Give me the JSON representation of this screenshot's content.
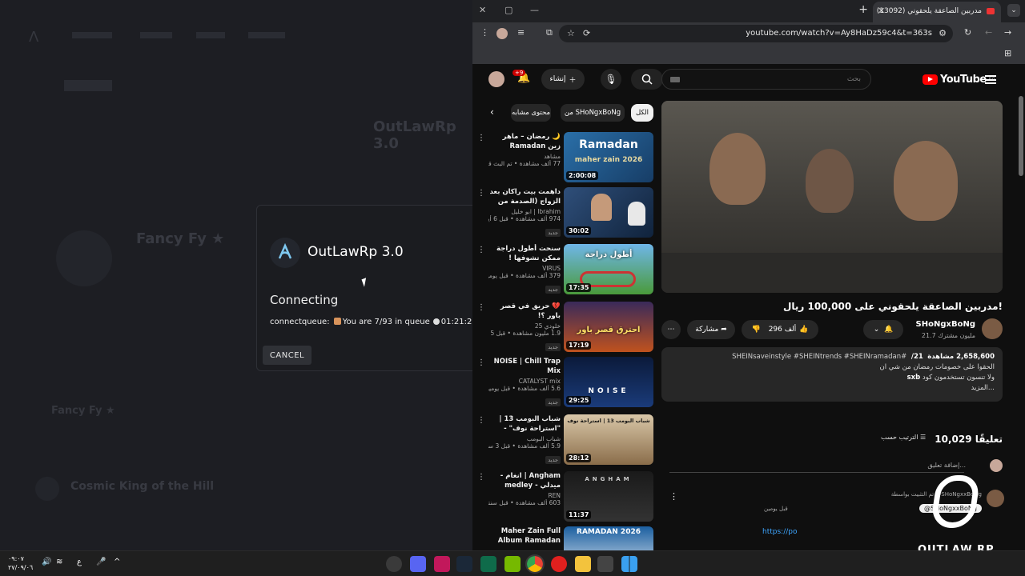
{
  "launcher": {
    "dialog_title": "OutLawRp 3.0",
    "status": "Connecting",
    "queue_text": "connectqueue: ",
    "queue_position": "You are 7/93 in queue",
    "queue_time": "01:21:21",
    "cancel_label": "CANCEL",
    "background": {
      "brand": "OutLawRp 3.0",
      "player_name": "Fancy Fy ★",
      "player_name2": "Fancy Fy ★",
      "song": "Cosmic King of the Hill"
    }
  },
  "browser": {
    "tab_title": "(13092) مدربين الصاعقة يلحقوني",
    "url": "youtube.com/watch?v=Ay8HaDz59c4&t=363s"
  },
  "youtube": {
    "logo_text": "YouTube",
    "region": "EG",
    "search_placeholder": "بحث",
    "create_label": "إنشاء",
    "notifications_badge": "+9",
    "video_title": "مدربين الصاعقة يلحقوني على 100,000 ريال!",
    "channel_name": "SHoNgxBoNg",
    "subscribers": "21.7 مليون مشترك",
    "likes": "296 ألف",
    "share_label": "مشاركة",
    "description": {
      "views": "2,658,600 مشاهدة",
      "age": "21/ ",
      "tags": "#SHEINsaveinstyle #SHEINtrends #SHEINramadan",
      "line1": "الحقوا على خصومات رمضان من شي ان",
      "line2_prefix": "ولا تنسون تستخدمون كود ",
      "code": "sxb",
      "more": "...المزيد"
    },
    "comments_count": "10,029 تعليقًا",
    "sort_label": "الترتيب حسب",
    "add_comment": "إضافة تعليق...",
    "pinned": {
      "pinned_by": "تم التثبيت بواسطة @SHoNgxxBoNg",
      "author": "@SHoNgxxBoNg",
      "age": "قبل يومين",
      "link": "https://po"
    },
    "chips": [
      "الكل",
      "من SHoNgxBoNg",
      "محتوى مشابه"
    ],
    "recommendations": [
      {
        "title": "🌙 رمضان – ماهر زين Ramadan (Arabic)...",
        "channel": "مشاهد",
        "views": "77 ألف مشاهدة • تم البث قبل أسبو...",
        "duration": "2:00:08",
        "new": "",
        "thumb_text": "Ramadan",
        "thumb_sub": "maher zain 2026"
      },
      {
        "title": "داهمت بيت راكان بعد الزواج (الصدمة من الزيار...",
        "channel": "Ibrahim | ابو خليل",
        "views": "974 ألف مشاهدة • قبل 6 أيام",
        "duration": "30:02",
        "new": "جديد",
        "thumb_text": "",
        "thumb_sub": ""
      },
      {
        "title": "سنحت أطول دراجة ممكن تشوفها !",
        "channel": "VIRUS",
        "views": "379 ألف مشاهدة • قبل يومين",
        "duration": "17:35",
        "new": "جديد",
        "thumb_text": "أطول دراجة",
        "thumb_sub": ""
      },
      {
        "title": "💔 حريق في قصر باور ؟!",
        "channel": "خلودي 25",
        "views": "1.9 مليون مشاهدة • قبل 5 أيام",
        "duration": "17:19",
        "new": "جديد",
        "thumb_text": "احترق قصر باور",
        "thumb_sub": ""
      },
      {
        "title": "NOISE | Chill Trap Mix",
        "channel": "CATALYST mix",
        "views": "5.6 ألف مشاهدة • قبل يومين",
        "duration": "29:25",
        "new": "جديد",
        "thumb_text": "NOISE",
        "thumb_sub": ""
      },
      {
        "title": "شباب البومب 13 | \"استراحة نوف\" - الحلقة ...",
        "channel": "شباب البومب",
        "views": "5.9 ألف مشاهدة • قبل 3 ساعات",
        "duration": "28:12",
        "new": "جديد",
        "thumb_text": "شباب البومب 13 | استراحة نوف",
        "thumb_sub": ""
      },
      {
        "title": "Angham | انغام - ميدلي - medley",
        "channel": "REN",
        "views": "603 ألف مشاهدة • قبل سنتين",
        "duration": "11:37",
        "new": "",
        "thumb_text": "ANGHAM",
        "thumb_sub": ""
      },
      {
        "title": "Maher Zain Full Album Ramadan ...",
        "channel": "",
        "views": "",
        "duration": "",
        "new": "",
        "thumb_text": "RAMADAN 2026",
        "thumb_sub": ""
      }
    ]
  },
  "watermark": {
    "text": "OUTLAW RP"
  },
  "taskbar": {
    "time": "٠٩:٠٧",
    "date": "٢٧/٠٩/٠٦",
    "lang": "ع"
  },
  "colors": {
    "yt_red": "#ff0000",
    "accent": "#3ea6ff",
    "bg": "#0f0f0f"
  }
}
